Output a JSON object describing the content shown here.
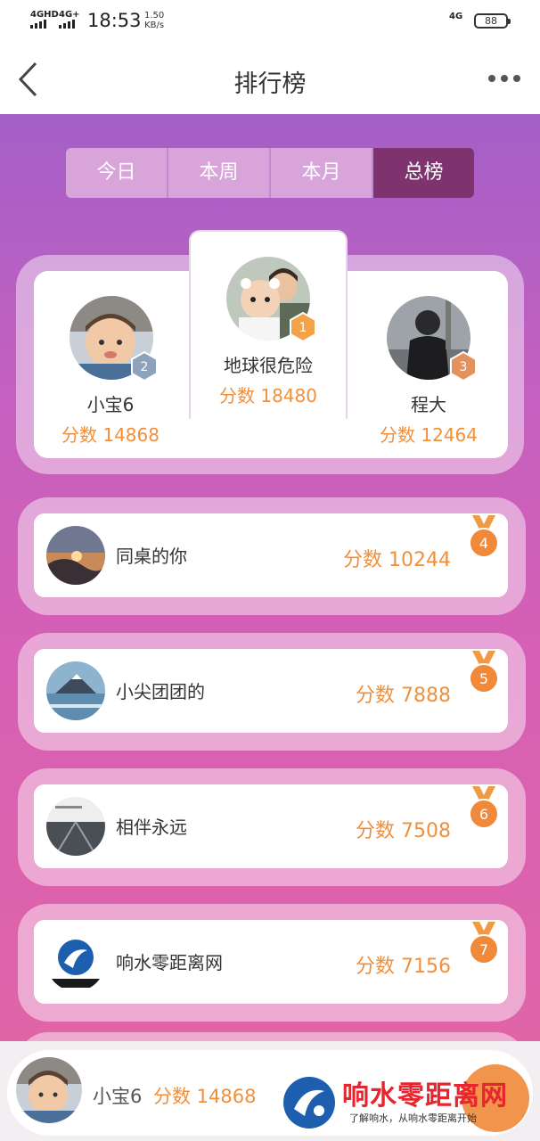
{
  "status": {
    "net1": "4GHD",
    "net2": "4G+",
    "time": "18:53",
    "speed_value": "1.50",
    "speed_unit": "KB/s",
    "net3": "4G",
    "battery": "88"
  },
  "nav": {
    "title": "排行榜"
  },
  "tabs": [
    {
      "label": "今日"
    },
    {
      "label": "本周"
    },
    {
      "label": "本月"
    },
    {
      "label": "总榜",
      "active": true
    }
  ],
  "podium": {
    "first": {
      "name": "地球很危险",
      "score": "分数 18480",
      "rank": "1"
    },
    "second": {
      "name": "小宝6",
      "score": "分数 14868",
      "rank": "2"
    },
    "third": {
      "name": "程大",
      "score": "分数 12464",
      "rank": "3"
    }
  },
  "rows": [
    {
      "rank": "4",
      "name": "同桌的你",
      "score": "分数 10244"
    },
    {
      "rank": "5",
      "name": "小尖团团的",
      "score": "分数 7888"
    },
    {
      "rank": "6",
      "name": "相伴永远",
      "score": "分数 7508"
    },
    {
      "rank": "7",
      "name": "响水零距离网",
      "score": "分数 7156"
    }
  ],
  "self": {
    "name": "小宝6",
    "score": "分数 14868"
  },
  "watermark": {
    "title": "响水零距离网",
    "subtitle": "了解响水，从响水零距离开始"
  },
  "colors": {
    "accent": "#f28f3a",
    "tab_active": "#7e336e",
    "gradient_top": "#a45fc7",
    "gradient_bottom": "#e064a8"
  }
}
